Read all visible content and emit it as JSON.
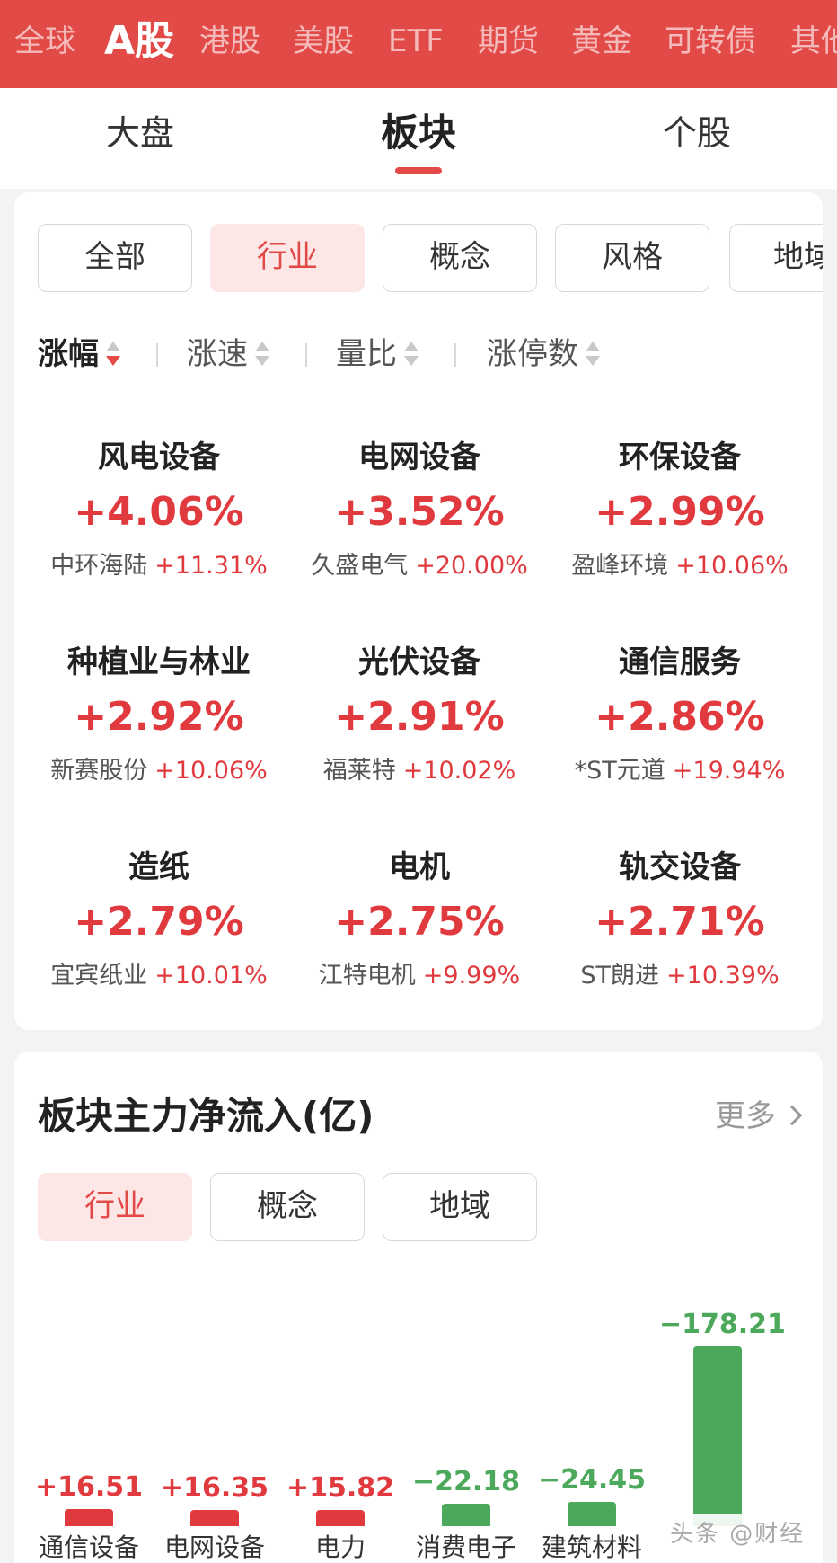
{
  "market_tabs": [
    {
      "label": "全球"
    },
    {
      "label": "A股",
      "active": true
    },
    {
      "label": "港股"
    },
    {
      "label": "美股"
    },
    {
      "label": "ETF"
    },
    {
      "label": "期货"
    },
    {
      "label": "黄金"
    },
    {
      "label": "可转债"
    },
    {
      "label": "其他"
    }
  ],
  "sub_tabs": [
    {
      "label": "大盘"
    },
    {
      "label": "板块",
      "active": true
    },
    {
      "label": "个股"
    }
  ],
  "sector_filters": [
    {
      "label": "全部"
    },
    {
      "label": "行业",
      "active": true
    },
    {
      "label": "概念"
    },
    {
      "label": "风格"
    },
    {
      "label": "地域"
    }
  ],
  "sort_options": [
    {
      "label": "涨幅",
      "active": true,
      "direction": "desc"
    },
    {
      "label": "涨速"
    },
    {
      "label": "量比"
    },
    {
      "label": "涨停数"
    }
  ],
  "sectors": [
    {
      "name": "风电设备",
      "change": "+4.06%",
      "leader": "中环海陆",
      "leader_change": "+11.31%"
    },
    {
      "name": "电网设备",
      "change": "+3.52%",
      "leader": "久盛电气",
      "leader_change": "+20.00%"
    },
    {
      "name": "环保设备",
      "change": "+2.99%",
      "leader": "盈峰环境",
      "leader_change": "+10.06%"
    },
    {
      "name": "种植业与林业",
      "change": "+2.92%",
      "leader": "新赛股份",
      "leader_change": "+10.06%"
    },
    {
      "name": "光伏设备",
      "change": "+2.91%",
      "leader": "福莱特",
      "leader_change": "+10.02%"
    },
    {
      "name": "通信服务",
      "change": "+2.86%",
      "leader": "*ST元道",
      "leader_change": "+19.94%"
    },
    {
      "name": "造纸",
      "change": "+2.79%",
      "leader": "宜宾纸业",
      "leader_change": "+10.01%"
    },
    {
      "name": "电机",
      "change": "+2.75%",
      "leader": "江特电机",
      "leader_change": "+9.99%"
    },
    {
      "name": "轨交设备",
      "change": "+2.71%",
      "leader": "ST朗进",
      "leader_change": "+10.39%"
    }
  ],
  "fund_flow": {
    "title": "板块主力净流入(亿)",
    "more_label": "更多",
    "filters": [
      {
        "label": "行业",
        "active": true
      },
      {
        "label": "概念"
      },
      {
        "label": "地域"
      }
    ],
    "bars": [
      {
        "label": "通信设备",
        "value": 16.51,
        "display": "+16.51"
      },
      {
        "label": "电网设备",
        "value": 16.35,
        "display": "+16.35"
      },
      {
        "label": "电力",
        "value": 15.82,
        "display": "+15.82"
      },
      {
        "label": "消费电子",
        "value": -22.18,
        "display": "−22.18"
      },
      {
        "label": "建筑材料",
        "value": -24.45,
        "display": "−24.45"
      },
      {
        "label": "",
        "value": -178.21,
        "display": "−178.21"
      }
    ]
  },
  "colors": {
    "brand": "#e24a47",
    "up": "#e0393e",
    "down": "#4ca85a"
  },
  "watermark": "头条 @财经"
}
